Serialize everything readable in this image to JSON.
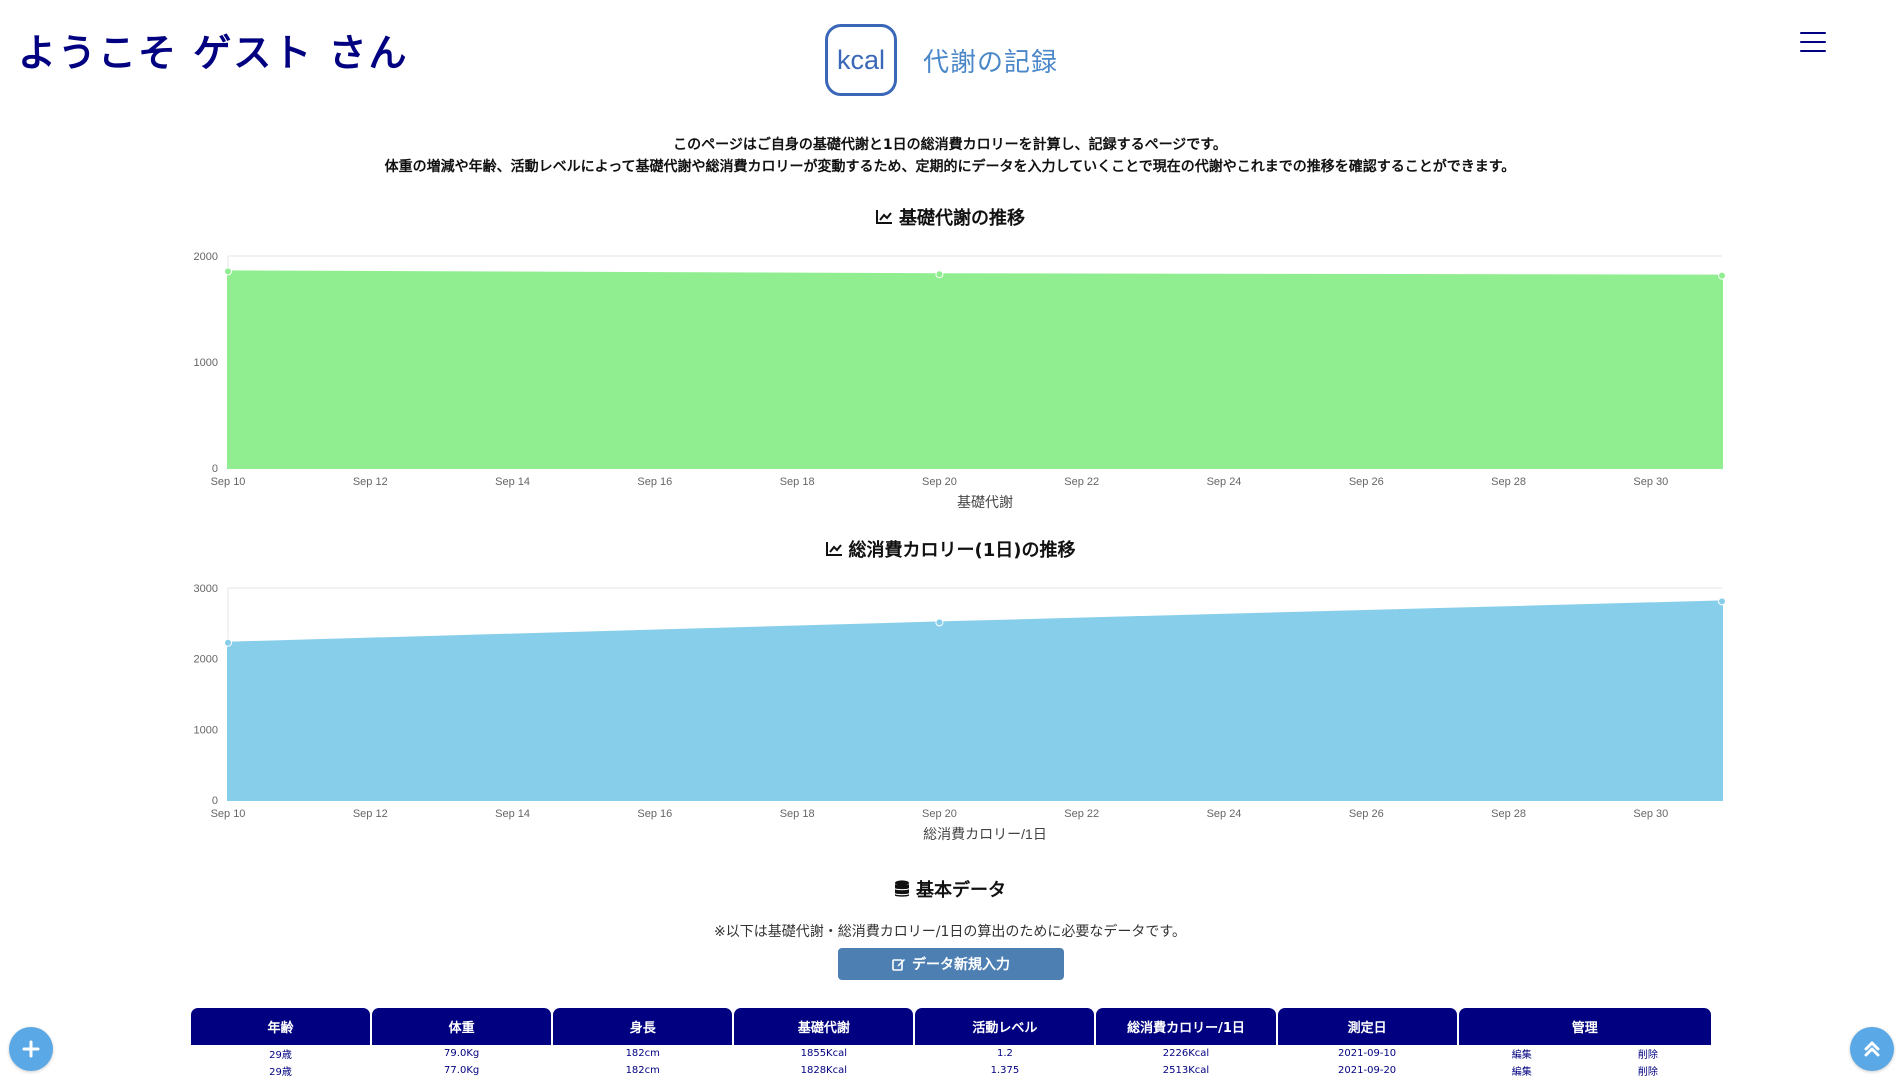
{
  "header": {
    "welcome": "ようこそ ゲスト さん",
    "logo_text": "kcal",
    "title": "代謝の記録"
  },
  "description": {
    "line1": "このページはご自身の基礎代謝と1日の総消費カロリーを計算し、記録するページです。",
    "line2": "体重の増減や年齢、活動レベルによって基礎代謝や総消費カロリーが変動するため、定期的にデータを入力していくことで現在の代謝やこれまでの推移を確認することができます。"
  },
  "charts": {
    "bmr_title": "基礎代謝の推移",
    "tdee_title": "総消費カロリー(1日)の推移"
  },
  "chart_data": [
    {
      "type": "area",
      "title": "基礎代謝の推移",
      "xlabel": "基礎代謝",
      "x_ticks": [
        "Sep 10",
        "Sep 12",
        "Sep 14",
        "Sep 16",
        "Sep 18",
        "Sep 20",
        "Sep 22",
        "Sep 24",
        "Sep 26",
        "Sep 28",
        "Sep 30"
      ],
      "y_ticks": [
        0,
        1000,
        2000
      ],
      "ylim": [
        0,
        2000
      ],
      "xlim": [
        "2021-09-10",
        "2021-10-01"
      ],
      "x": [
        "2021-09-10",
        "2021-09-20",
        "2021-10-01"
      ],
      "series": [
        {
          "values": [
            1855,
            1828,
            1815
          ]
        }
      ],
      "color": "#90ee90",
      "grid": true
    },
    {
      "type": "area",
      "title": "総消費カロリー(1日)の推移",
      "xlabel": "総消費カロリー/1日",
      "x_ticks": [
        "Sep 10",
        "Sep 12",
        "Sep 14",
        "Sep 16",
        "Sep 18",
        "Sep 20",
        "Sep 22",
        "Sep 24",
        "Sep 26",
        "Sep 28",
        "Sep 30"
      ],
      "y_ticks": [
        0,
        1000,
        2000,
        3000
      ],
      "ylim": [
        0,
        3000
      ],
      "xlim": [
        "2021-09-10",
        "2021-10-01"
      ],
      "x": [
        "2021-09-10",
        "2021-09-20",
        "2021-10-01"
      ],
      "series": [
        {
          "values": [
            2226,
            2513,
            2810
          ]
        }
      ],
      "color": "#87ceeb",
      "grid": true
    }
  ],
  "basic_data": {
    "title": "基本データ",
    "note": "※以下は基礎代謝・総消費カロリー/1日の算出のために必要なデータです。",
    "new_button": "データ新規入力"
  },
  "table": {
    "headers": [
      "年齢",
      "体重",
      "身長",
      "基礎代謝",
      "活動レベル",
      "総消費カロリー/1日",
      "測定日",
      "管理"
    ],
    "rows": [
      [
        "29歳",
        "79.0Kg",
        "182cm",
        "1855Kcal",
        "1.2",
        "2226Kcal",
        "2021-09-10"
      ],
      [
        "29歳",
        "77.0Kg",
        "182cm",
        "1828Kcal",
        "1.375",
        "2513Kcal",
        "2021-09-20"
      ]
    ],
    "edit_label": "編集",
    "delete_label": "削除"
  },
  "fab": {
    "add": "+",
    "top": "⌃"
  },
  "colors": {
    "navy": "#000080",
    "bmr_fill": "#90ee90",
    "tdee_fill": "#87ceeb",
    "button": "#4e7fb3",
    "fab": "#5aa9e6"
  }
}
